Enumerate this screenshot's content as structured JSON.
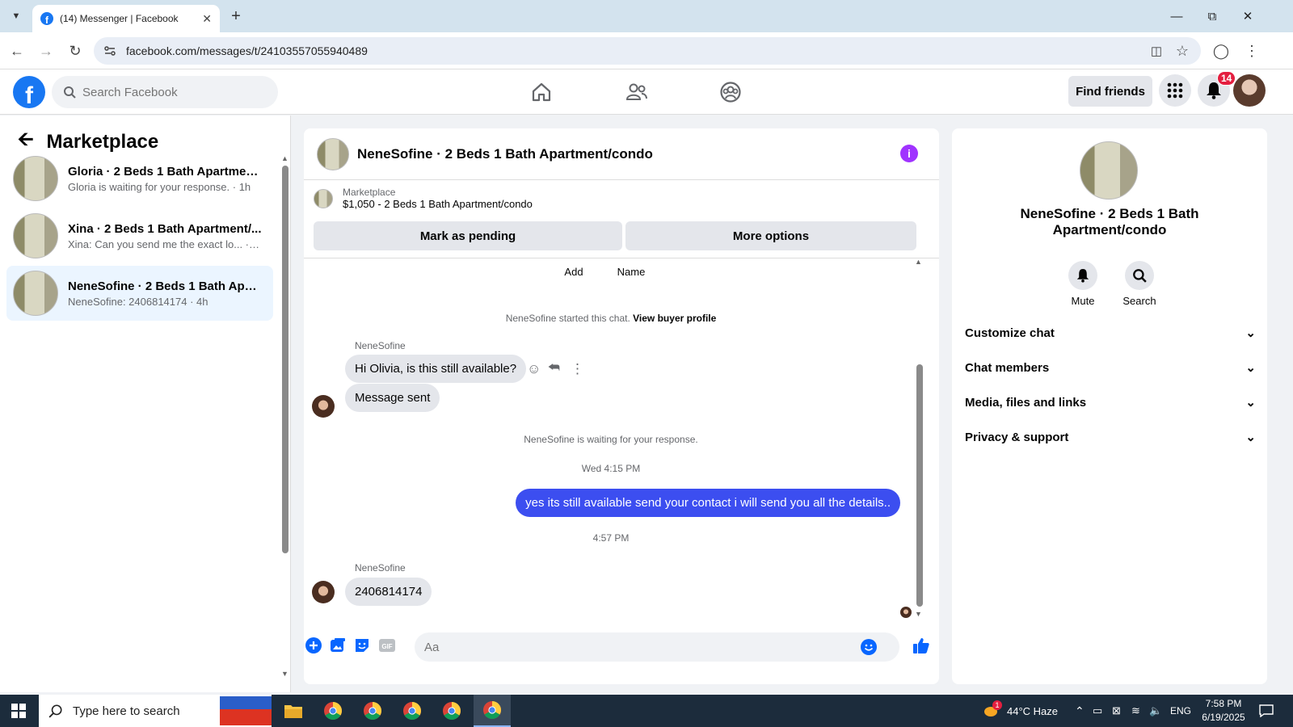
{
  "browser": {
    "tab_title": "(14) Messenger | Facebook",
    "url": "facebook.com/messages/t/24103557055940489"
  },
  "fb_header": {
    "search_placeholder": "Search Facebook",
    "find_friends": "Find friends",
    "notification_count": "14"
  },
  "sidebar": {
    "title": "Marketplace",
    "conversations": [
      {
        "name": "Gloria · 2 Beds 1 Bath Apartment...",
        "preview": "Gloria is waiting for your response. · 1h"
      },
      {
        "name": "Xina · 2 Beds 1 Bath Apartment/...",
        "preview": "Xina: Can you send me the exact lo... · 3h"
      },
      {
        "name": "NeneSofine · 2 Beds 1 Bath Apar...",
        "preview": "NeneSofine: 2406814174 · 4h"
      }
    ]
  },
  "chat": {
    "title": "NeneSofine · 2 Beds 1 Bath Apartment/condo",
    "marketplace_label": "Marketplace",
    "listing": "$1,050 - 2 Beds 1 Bath Apartment/condo",
    "mark_pending": "Mark as pending",
    "more_options": "More options",
    "partial_add": "Add",
    "partial_name": "Name",
    "started_text": "NeneSofine started this chat.",
    "view_buyer": "View buyer profile",
    "sender1": "NeneSofine",
    "msg1": "Hi Olivia, is this still available?",
    "msg2": "Message sent",
    "waiting": "NeneSofine is waiting for your response.",
    "time1": "Wed 4:15 PM",
    "my_msg": "yes its still available send your contact i will send you all the details..",
    "time2": "4:57 PM",
    "sender2": "NeneSofine",
    "msg3": "2406814174",
    "composer_placeholder": "Aa"
  },
  "right_panel": {
    "name_line1": "NeneSofine · 2 Beds 1 Bath",
    "name_line2": "Apartment/condo",
    "mute": "Mute",
    "search": "Search",
    "sections": [
      "Customize chat",
      "Chat members",
      "Media, files and links",
      "Privacy & support"
    ]
  },
  "taskbar": {
    "search_placeholder": "Type here to search",
    "weather_badge": "1",
    "weather": "44°C  Haze",
    "lang": "ENG",
    "time": "7:58 PM",
    "date": "6/19/2025"
  },
  "colors": {
    "fb_blue": "#1877f2",
    "my_bubble": "#3c4ef0",
    "active_conv": "#ebf5ff",
    "info_purple": "#a033ff"
  }
}
